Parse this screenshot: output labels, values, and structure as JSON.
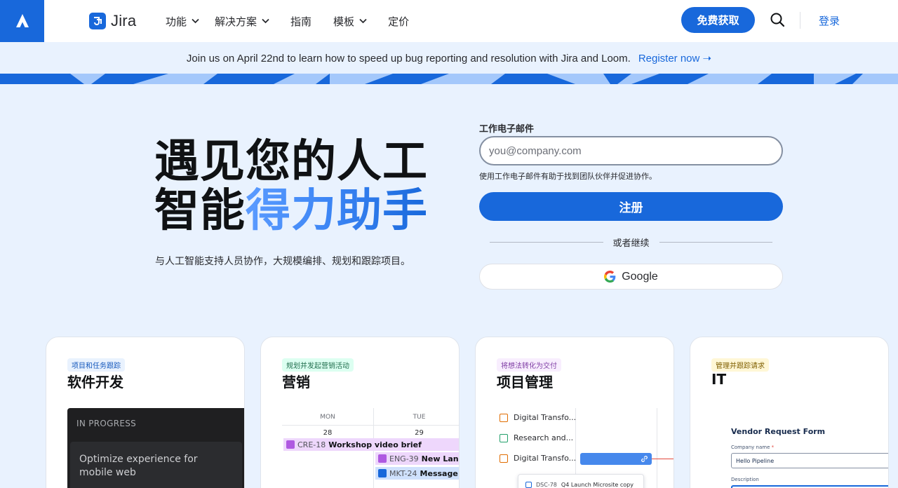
{
  "header": {
    "brand": "Jira",
    "nav": [
      {
        "label": "功能",
        "has_dropdown": true
      },
      {
        "label": "解决方案",
        "has_dropdown": true
      },
      {
        "label": "指南",
        "has_dropdown": false
      },
      {
        "label": "模板",
        "has_dropdown": true
      },
      {
        "label": "定价",
        "has_dropdown": false
      }
    ],
    "cta_label": "免费获取",
    "login_label": "登录"
  },
  "banner": {
    "text": "Join us on April 22nd to learn how to speed up bug reporting and resolution with Jira and Loom.",
    "link_label": "Register now ➝"
  },
  "hero": {
    "title_line1": "遇见您的人工",
    "title_line2_plain": "智能",
    "title_line2_accent": "得力助手",
    "subtitle": "与人工智能支持人员协作，大规模编排、规划和跟踪项目。"
  },
  "signup": {
    "email_label": "工作电子邮件",
    "email_placeholder": "you@company.com",
    "email_help": "使用工作电子邮件有助于找到团队伙伴并促进协作。",
    "submit_label": "注册",
    "or_label": "或者继续",
    "google_label": "Google"
  },
  "cards": [
    {
      "pill": "项目和任务跟踪",
      "title": "软件开发",
      "panel_label": "IN PROGRESS",
      "panel_item": "Optimize experience for mobile web"
    },
    {
      "pill": "规划并发起营销活动",
      "title": "营销",
      "days": [
        "MON",
        "TUE"
      ],
      "dates": [
        "28",
        "29"
      ],
      "events": [
        {
          "key": "CRE-18",
          "name": "Workshop video brief"
        },
        {
          "key": "ENG-39",
          "name": "New Landing"
        },
        {
          "key": "MKT-24",
          "name": "Message hou"
        }
      ]
    },
    {
      "pill": "将想法转化为交付",
      "title": "项目管理",
      "rows": [
        "Digital Transfo...",
        "Research and...",
        "Digital Transfo..."
      ],
      "sub_key": "DSC-78",
      "sub_name": "Q4 Launch Microsite copy"
    },
    {
      "pill": "管理并跟踪请求",
      "title": "IT",
      "form_title": "Vendor Request Form",
      "field1_label": "Company name",
      "field1_required": "*",
      "field1_value": "Hello Pipeline",
      "field2_label": "Description"
    }
  ],
  "colors": {
    "primary": "#1868db",
    "page_bg": "#e9f2fe",
    "heading": "#101214"
  }
}
